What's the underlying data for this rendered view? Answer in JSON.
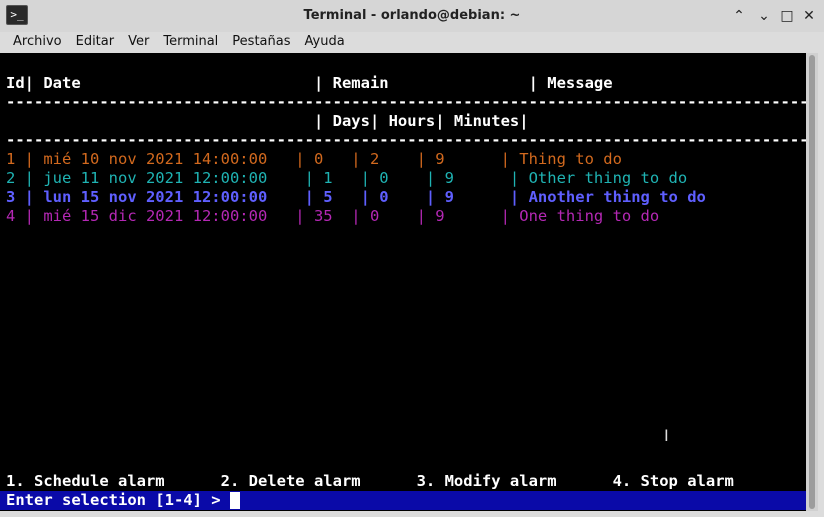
{
  "window": {
    "title": "Terminal - orlando@debian: ~",
    "app_icon": ">_",
    "controls": {
      "minimize": "⌃",
      "restore": "⌄",
      "maximize": "□",
      "close": "✕"
    }
  },
  "menubar": [
    "Archivo",
    "Editar",
    "Ver",
    "Terminal",
    "Pestañas",
    "Ayuda"
  ],
  "terminal": {
    "header1": "Id| Date                         | Remain               | Message",
    "separator": "--------------------------------------------------------------------------------------------------------",
    "header2": "                                 | Days| Hours| Minutes|",
    "rows": [
      {
        "text": "1 | mié 10 nov 2021 14:00:00   | 0   | 2    | 9      | Thing to do",
        "color": "#d2691e"
      },
      {
        "text": "2 | jue 11 nov 2021 12:00:00    | 1   | 0    | 9      | Other thing to do",
        "color": "#1fb3b3"
      },
      {
        "text": "3 | lun 15 nov 2021 12:00:00    | 5   | 0    | 9      | Another thing to do",
        "color": "#5f5fff"
      },
      {
        "text": "4 | mié 15 dic 2021 12:00:00   | 35  | 0    | 9      | One thing to do",
        "color": "#b428b4"
      }
    ],
    "menu_options": "1. Schedule alarm      2. Delete alarm      3. Modify alarm      4. Stop alarm",
    "prompt": "Enter selection [1-4] > "
  }
}
